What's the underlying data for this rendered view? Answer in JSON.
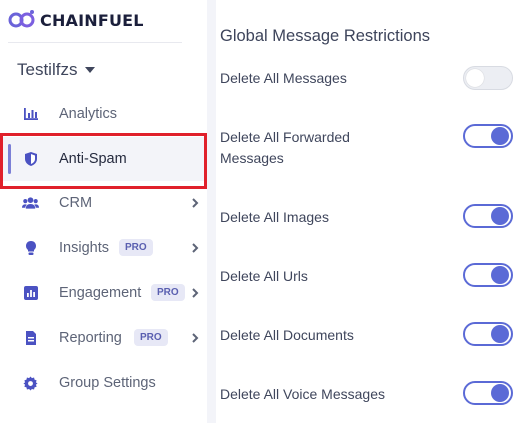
{
  "brand": {
    "name": "CHAINFUEL"
  },
  "workspace": {
    "name": "Testilfzs"
  },
  "nav": {
    "items": [
      {
        "label": "Analytics",
        "icon": "bar-chart-icon"
      },
      {
        "label": "Anti-Spam",
        "icon": "shield-icon",
        "active": true
      },
      {
        "label": "CRM",
        "icon": "users-icon"
      },
      {
        "label": "Insights",
        "icon": "lightbulb-icon",
        "badge": "PRO"
      },
      {
        "label": "Engagement",
        "icon": "chart-square-icon",
        "badge": "PRO"
      },
      {
        "label": "Reporting",
        "icon": "document-icon",
        "badge": "PRO"
      },
      {
        "label": "Group Settings",
        "icon": "gear-icon"
      }
    ]
  },
  "main": {
    "title": "Global Message Restrictions",
    "settings": [
      {
        "label": "Delete All Messages",
        "enabled": false
      },
      {
        "label": "Delete All Forwarded Messages",
        "enabled": true
      },
      {
        "label": "Delete All Images",
        "enabled": true
      },
      {
        "label": "Delete All Urls",
        "enabled": true
      },
      {
        "label": "Delete All Documents",
        "enabled": true
      },
      {
        "label": "Delete All Voice Messages",
        "enabled": true
      }
    ]
  },
  "colors": {
    "accent": "#5b6ad6",
    "highlight": "#e0202b",
    "sidebar_active_bg": "#f3f4f9",
    "pro_badge_bg": "#e7e8f6"
  }
}
